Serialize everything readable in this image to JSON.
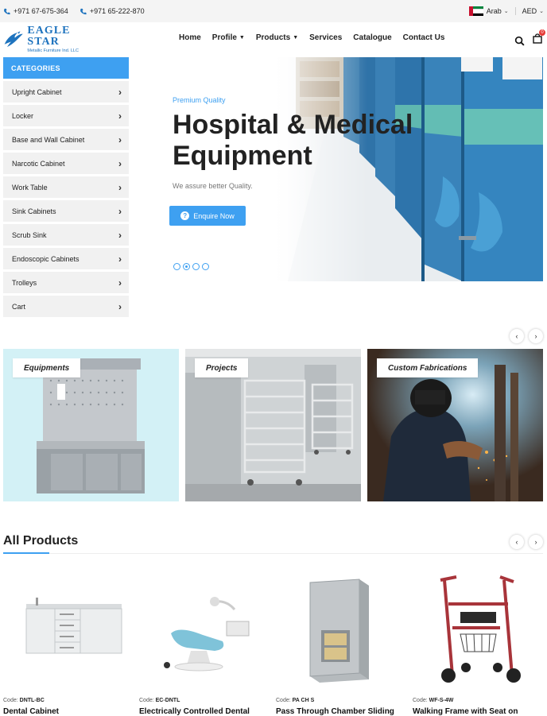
{
  "topbar": {
    "phone1": "+971 67-675-364",
    "phone2": "+971 65-222-870",
    "language": "Arab",
    "currency": "AED"
  },
  "header": {
    "logo_main": "EAGLE STAR",
    "logo_sub": "Metallic Furniture Ind. LLC",
    "nav": [
      {
        "label": "Home",
        "dropdown": false
      },
      {
        "label": "Profile",
        "dropdown": true
      },
      {
        "label": "Products",
        "dropdown": true
      },
      {
        "label": "Services",
        "dropdown": false
      },
      {
        "label": "Catalogue",
        "dropdown": false
      },
      {
        "label": "Contact Us",
        "dropdown": false
      }
    ],
    "cart_count": "0"
  },
  "categories": {
    "heading": "CATEGORIES",
    "items": [
      "Upright Cabinet",
      "Locker",
      "Base and Wall Cabinet",
      "Narcotic Cabinet",
      "Work Table",
      "Sink Cabinets",
      "Scrub Sink",
      "Endoscopic Cabinets",
      "Trolleys",
      "Cart"
    ]
  },
  "hero": {
    "kicker": "Premium Quality",
    "title_line1": "Hospital & Medical",
    "title_line2": "Equipment",
    "subtitle": "We assure better Quality.",
    "button": "Enquire Now",
    "slides": 4,
    "active_slide": 2
  },
  "tiles": [
    {
      "label": "Equipments"
    },
    {
      "label": "Projects"
    },
    {
      "label": "Custom Fabrications"
    }
  ],
  "products_section": {
    "title": "All Products",
    "code_label": "Code:",
    "items": [
      {
        "code": "DNTL-BC",
        "name": "Dental Cabinet"
      },
      {
        "code": "EC-DNTL",
        "name": "Electrically Controlled Dental"
      },
      {
        "code": "PA CH S",
        "name": "Pass Through Chamber Sliding"
      },
      {
        "code": "WF-S-4W",
        "name": "Walking Frame with Seat on"
      }
    ]
  },
  "nav_arrows": {
    "prev": "‹",
    "next": "›"
  },
  "colors": {
    "accent": "#3ea0f1",
    "brand": "#1e73be"
  }
}
